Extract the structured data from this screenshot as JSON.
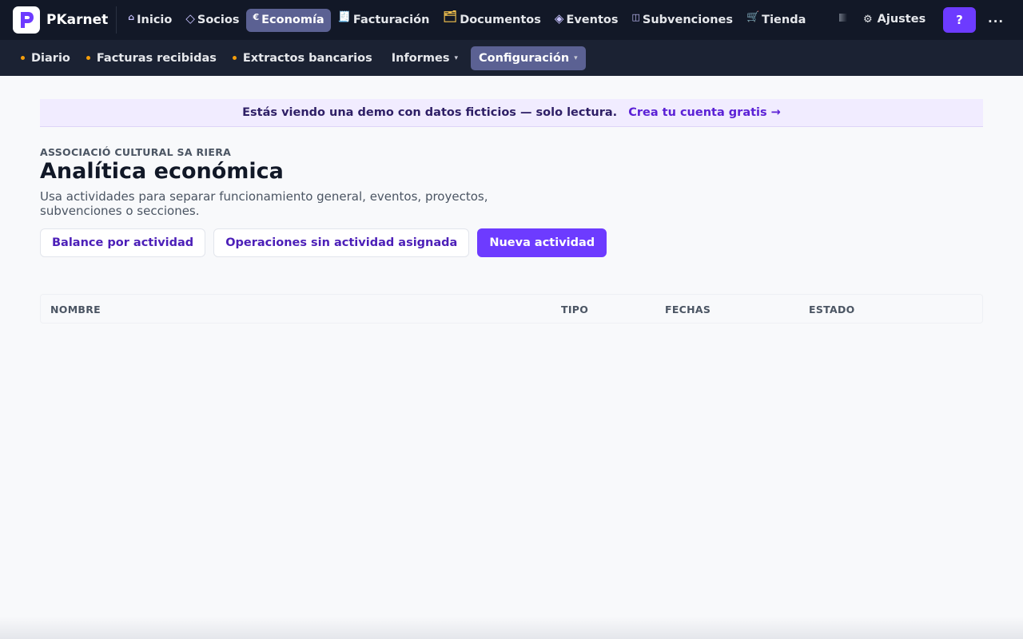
{
  "app": {
    "name": "PKarnet"
  },
  "topnav": {
    "items": [
      {
        "label": "Inicio",
        "icon": "home-icon",
        "glyph": "⌂"
      },
      {
        "label": "Socios",
        "icon": "diamond-icon",
        "glyph": "◇"
      },
      {
        "label": "Economía",
        "icon": "euro-icon",
        "glyph": "€"
      },
      {
        "label": "Facturación",
        "icon": "receipt-icon",
        "glyph": "🧾"
      },
      {
        "label": "Documentos",
        "icon": "folder-icon",
        "glyph": "🗂"
      },
      {
        "label": "Eventos",
        "icon": "event-diamond-icon",
        "glyph": "◈"
      },
      {
        "label": "Subvenciones",
        "icon": "grants-icon",
        "glyph": "◫"
      },
      {
        "label": "Tienda",
        "icon": "cart-icon",
        "glyph": "🛒"
      }
    ],
    "active": "Economía",
    "settings_label": "Ajustes",
    "settings_glyph": "⚙",
    "help_label": "?",
    "more_label": "..."
  },
  "subnav": {
    "items": [
      {
        "label": "Diario",
        "dot": true
      },
      {
        "label": "Facturas recibidas",
        "dot": true
      },
      {
        "label": "Extractos bancarios",
        "dot": true
      },
      {
        "label": "Informes",
        "caret": true
      },
      {
        "label": "Configuración",
        "caret": true
      }
    ],
    "caret_glyph": "▾"
  },
  "banner": {
    "message": "Estás viendo una demo con datos ficticios — solo lectura.",
    "cta": "Crea tu cuenta gratis →"
  },
  "header": {
    "org": "ASSOCIACIÓ CULTURAL SA RIERA",
    "title": "Analítica económica",
    "description": "Usa actividades para separar funcionamiento general, eventos, proyectos, subvenciones o secciones."
  },
  "actions": {
    "balance": "Balance por actividad",
    "unassigned": "Operaciones sin actividad asignada",
    "new": "Nueva actividad"
  },
  "table": {
    "columns": [
      "NOMBRE",
      "TIPO",
      "FECHAS",
      "ESTADO"
    ]
  },
  "colors": {
    "accent": "#6d3bff",
    "nav_bg": "#121827",
    "subnav_bg": "#1b2233",
    "active_tab": "#5b6193",
    "dot": "#f59e0b"
  }
}
